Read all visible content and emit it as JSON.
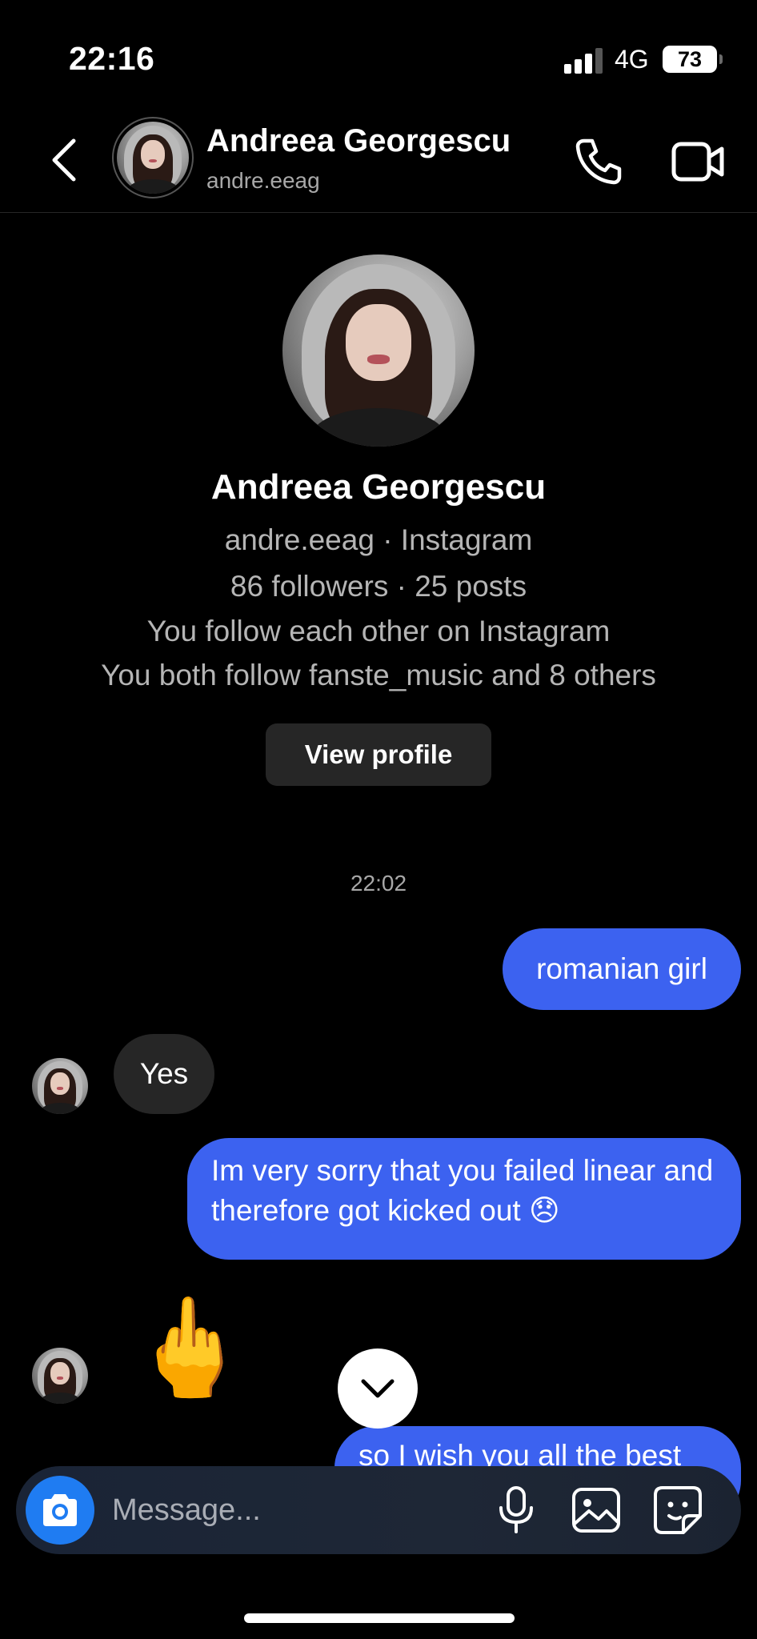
{
  "status_bar": {
    "time": "22:16",
    "network": "4G",
    "battery": "73",
    "battery_level": 0.73
  },
  "header": {
    "name": "Andreea Georgescu",
    "username": "andre.eeag",
    "icons": [
      "back-chevron-icon",
      "phone-icon",
      "video-camera-icon"
    ]
  },
  "profile": {
    "name": "Andreea Georgescu",
    "subtitle": "andre.eeag · Instagram",
    "stats": "86 followers · 25 posts",
    "mutual": "You follow each other on Instagram",
    "mutual_follows": "You both follow fanste_music and 8 others",
    "view_profile_label": "View profile"
  },
  "thread": {
    "timestamp": "22:02",
    "messages": [
      {
        "direction": "out",
        "text": "romanian girl"
      },
      {
        "direction": "in",
        "text": "Yes"
      },
      {
        "direction": "out",
        "text": "Im very sorry that you failed linear and therefore got kicked out 😞"
      },
      {
        "direction": "in",
        "text": "🖕"
      },
      {
        "direction": "out",
        "text": "so I wish you all the best"
      }
    ]
  },
  "composer": {
    "placeholder": "Message...",
    "icons": [
      "camera-icon",
      "microphone-icon",
      "gallery-icon",
      "sticker-icon"
    ]
  },
  "colors": {
    "outgoing_bubble": "#3c62f0",
    "incoming_bubble": "#262626",
    "camera_button": "#1f7cf2"
  }
}
